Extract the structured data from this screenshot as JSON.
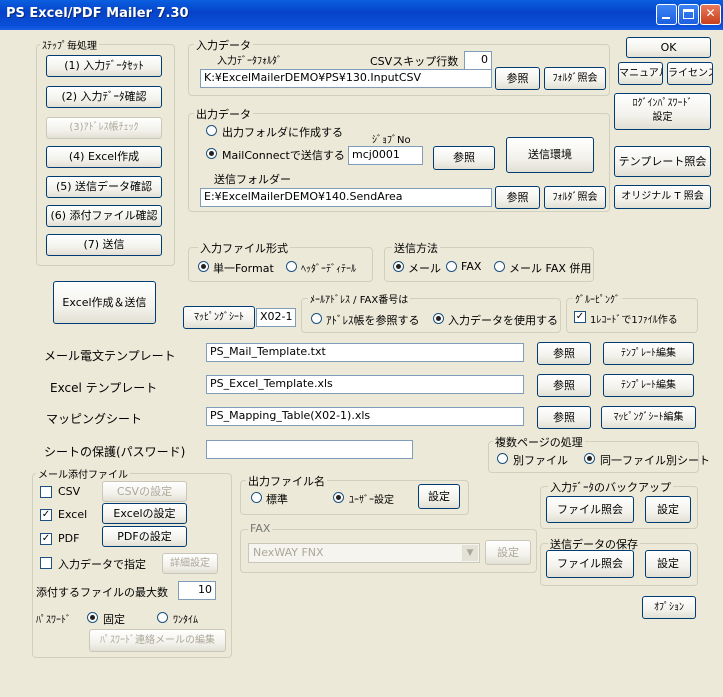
{
  "window": {
    "title": "PS Excel/PDF Mailer 7.30"
  },
  "steps": {
    "title": "ｽﾃｯﾌﾟ毎処理",
    "items": [
      "(1) 入力ﾃﾞｰﾀｾｯﾄ",
      "(2) 入力ﾃﾞｰﾀ確認",
      "(3)ｱﾄﾞﾚｽ帳ﾁｪｯｸ",
      "(4) Excel作成",
      "(5) 送信データ確認",
      "(6) 添付ファイル確認",
      "(7) 送信"
    ]
  },
  "input_data": {
    "title": "入力データ",
    "folder_label": "入力ﾃﾞｰﾀﾌｫﾙﾀﾞ",
    "csv_skip_label": "CSVスキップ行数",
    "csv_skip_value": "0",
    "folder_path": "K:¥ExcelMailerDEMO¥PS¥130.InputCSV",
    "browse": "参照",
    "folder_view": "ﾌｫﾙﾀﾞ照会"
  },
  "output_data": {
    "title": "出力データ",
    "opt_folder": "出力フォルダに作成する",
    "opt_mailconnect": "MailConnectで送信する",
    "job_label": "ｼﾞｮﾌﾞNo",
    "job_value": "mcj0001",
    "browse_job": "参照",
    "send_env": "送信環境",
    "send_folder_label": "送信フォルダー",
    "send_folder_path": "E:¥ExcelMailerDEMO¥140.SendArea",
    "browse": "参照",
    "folder_view": "ﾌｫﾙﾀﾞ照会"
  },
  "right": {
    "ok": "OK",
    "manual": "マニュアル",
    "license": "ライセンス",
    "login_pw": [
      "ﾛｸﾞｲﾝﾊﾟｽﾜｰﾄﾞ",
      "設定"
    ],
    "template_view": "テンプレート照会",
    "original_view": "オリジナル T 照会",
    "option": "ｵﾌﾟｼｮﾝ"
  },
  "input_format": {
    "title": "入力ファイル形式",
    "opt_single": "単一Format",
    "opt_header": "ﾍｯﾀﾞｰﾃﾞｨﾃｰﾙ"
  },
  "send_method": {
    "title": "送信方法",
    "opt_mail": "メール",
    "opt_fax": "FAX",
    "opt_both": "メール FAX 併用"
  },
  "main": {
    "excel_send": "Excel作成＆送信",
    "mapping_sheet": "ﾏｯﾋﾟﾝｸﾞｼｰﾄ",
    "mapping_value": "X02-1"
  },
  "address": {
    "title": "ﾒｰﾙｱﾄﾞﾚｽ / FAX番号は",
    "opt_book": "ｱﾄﾞﾚｽ帳を参照する",
    "opt_input": "入力データを使用する"
  },
  "grouping": {
    "title": "ｸﾞﾙｰﾋﾟﾝｸﾞ",
    "label": "1ﾚｺｰﾄﾞで1ﾌｧｲﾙ作る"
  },
  "templates": {
    "mail_label": "メール電文テンプレート",
    "mail_value": "PS_Mail_Template.txt",
    "excel_label": "Excel テンプレート",
    "excel_value": "PS_Excel_Template.xls",
    "mapping_label": "マッピングシート",
    "mapping_value": "PS_Mapping_Table(X02-1).xls",
    "browse": "参照",
    "template_edit": "ﾃﾝﾌﾟﾚｰﾄ編集",
    "mapping_edit": "ﾏｯﾋﾟﾝｸﾞｼｰﾄ編集",
    "sheet_protect_label": "シートの保護(パスワード)",
    "sheet_protect_value": ""
  },
  "multipage": {
    "title": "複数ページの処理",
    "opt_separate": "別ファイル",
    "opt_same": "同一ファイル別シート"
  },
  "attach": {
    "title": "メール添付ファイル",
    "csv": "CSV",
    "csv_setting": "CSVの設定",
    "excel": "Excel",
    "excel_setting": "Excelの設定",
    "pdf": "PDF",
    "pdf_setting": "PDFの設定",
    "input_specify": "入力データで指定",
    "detail_setting": "詳細設定",
    "max_label": "添付するファイルの最大数",
    "max_value": "10",
    "pw_label": "ﾊﾟｽﾜｰﾄﾞ",
    "opt_fixed": "固定",
    "opt_onetime": "ﾜﾝﾀｲﾑ",
    "pw_mail_edit": "ﾊﾟｽﾜｰﾄﾞ連絡メールの編集"
  },
  "output_name": {
    "title": "出力ファイル名",
    "opt_standard": "標準",
    "opt_user": "ﾕｰｻﾞｰ設定",
    "setting": "設定"
  },
  "fax": {
    "title": "FAX",
    "selected": "NexWAY FNX",
    "setting": "設定"
  },
  "backup": {
    "title": "入力ﾃﾞｰﾀのバックアップ",
    "file_view": "ファイル照会",
    "setting": "設定"
  },
  "save": {
    "title": "送信データの保存",
    "file_view": "ファイル照会",
    "setting": "設定"
  }
}
